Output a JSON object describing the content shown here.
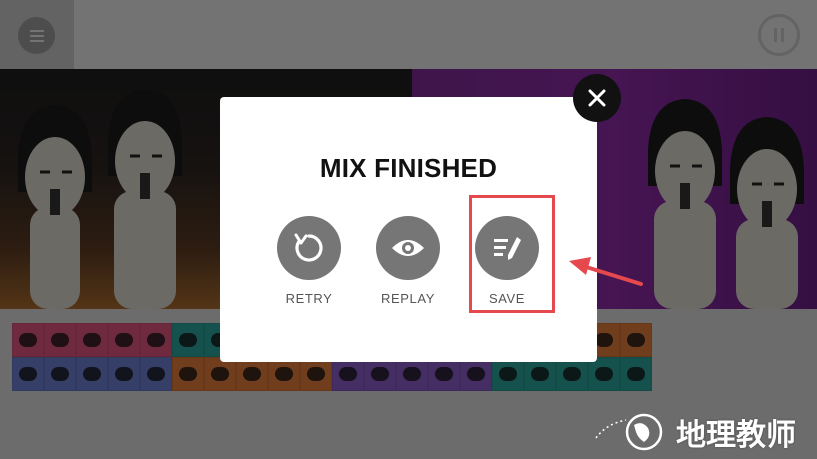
{
  "topbar": {
    "menu_icon": "menu-icon",
    "pause_icon": "pause-icon"
  },
  "dialog": {
    "title": "MIX FINISHED",
    "actions": [
      {
        "label": "RETRY",
        "icon": "retry-icon"
      },
      {
        "label": "REPLAY",
        "icon": "eye-icon"
      },
      {
        "label": "SAVE",
        "icon": "edit-icon"
      }
    ],
    "close_icon": "close-icon"
  },
  "annotation": {
    "highlight_color": "#e5484d",
    "highlighted_action": "SAVE"
  },
  "watermark": {
    "text": "地理教师"
  },
  "colors": {
    "modal_bg": "#ffffff",
    "action_circle": "#767676",
    "stage_left": "#2b2421",
    "stage_right": "#8c2aa5",
    "tray_pink": "#e0557e",
    "tray_teal": "#2aa39a",
    "tray_orange": "#e07a3a",
    "tray_purple": "#8b5cc9",
    "tray_blue": "#6a7fd0"
  }
}
